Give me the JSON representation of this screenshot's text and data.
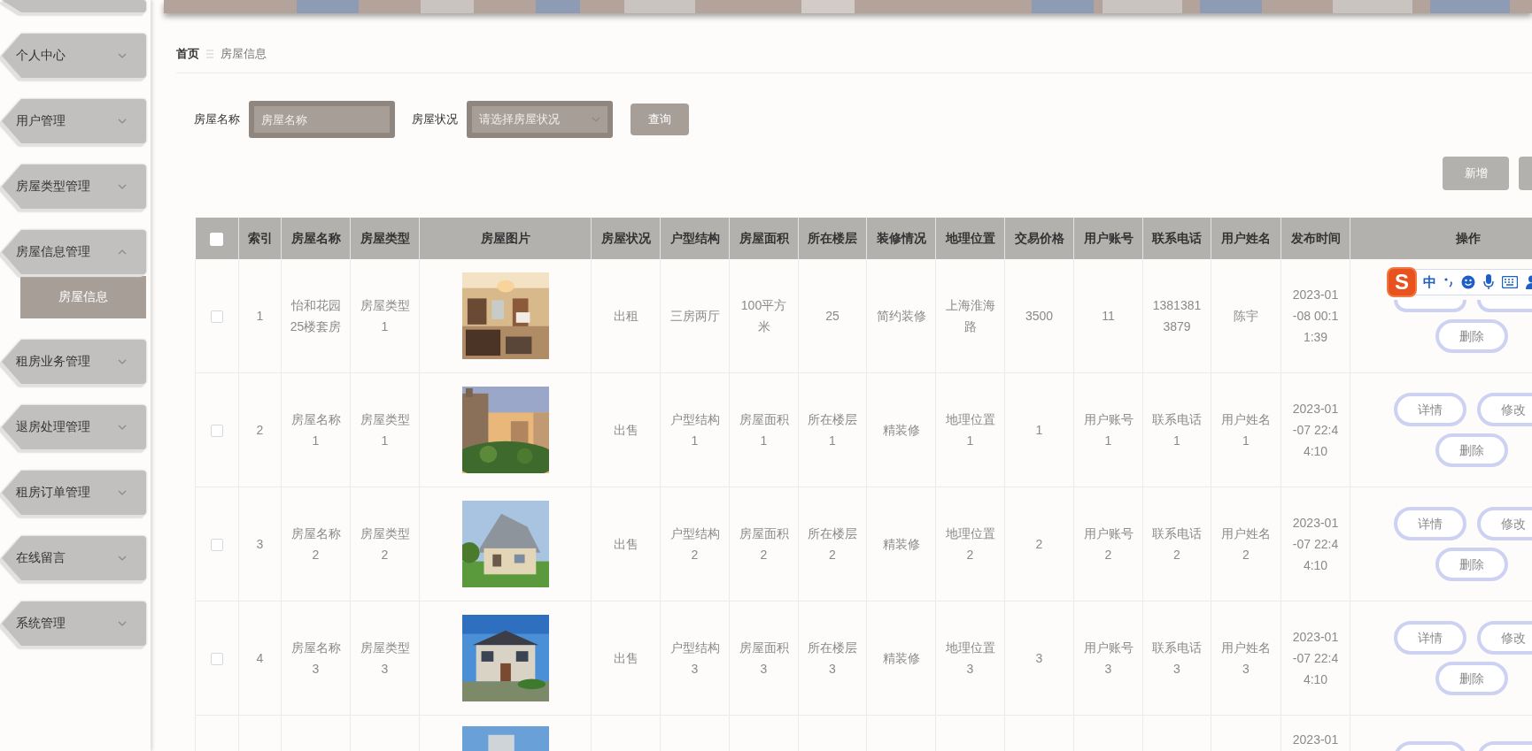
{
  "banner": {
    "kind": "picture"
  },
  "sidebar": {
    "items": [
      {
        "kind": "clipped"
      },
      {
        "kind": "menu",
        "label": "个人中心",
        "expanded": false
      },
      {
        "kind": "menu",
        "label": "用户管理",
        "expanded": false
      },
      {
        "kind": "menu",
        "label": "房屋类型管理",
        "expanded": false
      },
      {
        "kind": "menu",
        "label": "房屋信息管理",
        "expanded": true,
        "children": [
          {
            "label": "房屋信息",
            "selected": true
          }
        ]
      },
      {
        "kind": "menu",
        "label": "租房业务管理",
        "expanded": false
      },
      {
        "kind": "menu",
        "label": "退房处理管理",
        "expanded": false
      },
      {
        "kind": "menu",
        "label": "租房订单管理",
        "expanded": false
      },
      {
        "kind": "menu",
        "label": "在线留言",
        "expanded": false
      },
      {
        "kind": "menu",
        "label": "系统管理",
        "expanded": false
      }
    ]
  },
  "breadcrumb": [
    "首页",
    "房屋信息"
  ],
  "search": {
    "fields": [
      {
        "kind": "input",
        "label": "房屋名称",
        "placeholder": "房屋名称"
      },
      {
        "kind": "select",
        "label": "房屋状况",
        "placeholder": "请选择房屋状况"
      }
    ],
    "button": "查询"
  },
  "toolbar": {
    "buttons": [
      {
        "kind": "button",
        "label": "新增"
      },
      {
        "kind": "clipped"
      }
    ]
  },
  "table": {
    "header_checked": false,
    "columns": [
      "索引",
      "房屋名称",
      "房屋类型",
      "房屋图片",
      "房屋状况",
      "户型结构",
      "房屋面积",
      "所在楼层",
      "装修情况",
      "地理位置",
      "交易价格",
      "用户账号",
      "联系电话",
      "用户姓名",
      "发布时间",
      "操作"
    ],
    "rows": [
      {
        "checked": false,
        "cells": [
          "1",
          "怡和花园25楼套房",
          "房屋类型1",
          null,
          "出租",
          "三房两厅",
          "100平方米",
          "25",
          "简约装修",
          "上海淮海路",
          "3500",
          "11",
          "13813813879",
          "陈宇",
          "2023-01-08 00:11:39"
        ],
        "actions": [
          {
            "kind": "covered"
          },
          {
            "kind": "covered"
          },
          {
            "kind": "button",
            "label": "删除"
          }
        ]
      },
      {
        "checked": false,
        "cells": [
          "2",
          "房屋名称1",
          "房屋类型1",
          null,
          "出售",
          "户型结构1",
          "房屋面积1",
          "所在楼层1",
          "精装修",
          "地理位置1",
          "1",
          "用户账号1",
          "联系电话1",
          "用户姓名1",
          "2023-01-07 22:44:10"
        ],
        "actions": [
          {
            "kind": "button",
            "label": "详情"
          },
          {
            "kind": "button",
            "label": "修改"
          },
          {
            "kind": "button",
            "label": "删除"
          }
        ]
      },
      {
        "checked": false,
        "cells": [
          "3",
          "房屋名称2",
          "房屋类型2",
          null,
          "出售",
          "户型结构2",
          "房屋面积2",
          "所在楼层2",
          "精装修",
          "地理位置2",
          "2",
          "用户账号2",
          "联系电话2",
          "用户姓名2",
          "2023-01-07 22:44:10"
        ],
        "actions": [
          {
            "kind": "button",
            "label": "详情"
          },
          {
            "kind": "button",
            "label": "修改"
          },
          {
            "kind": "button",
            "label": "删除"
          }
        ]
      },
      {
        "checked": false,
        "cells": [
          "4",
          "房屋名称3",
          "房屋类型3",
          null,
          "出售",
          "户型结构3",
          "房屋面积3",
          "所在楼层3",
          "精装修",
          "地理位置3",
          "3",
          "用户账号3",
          "联系电话3",
          "用户姓名3",
          "2023-01-07 22:44:10"
        ],
        "actions": [
          {
            "kind": "button",
            "label": "详情"
          },
          {
            "kind": "button",
            "label": "修改"
          },
          {
            "kind": "button",
            "label": "删除"
          }
        ]
      },
      {
        "kind": "clipped",
        "cells": [
          "",
          "",
          "",
          null,
          "",
          "",
          "",
          "",
          "",
          "",
          "",
          "",
          "",
          "",
          "2023-01"
        ],
        "actions": [
          {
            "kind": "cut"
          },
          {
            "kind": "cut"
          }
        ]
      }
    ]
  },
  "ime_toolbar": {
    "logo": "S",
    "mode": "中"
  }
}
